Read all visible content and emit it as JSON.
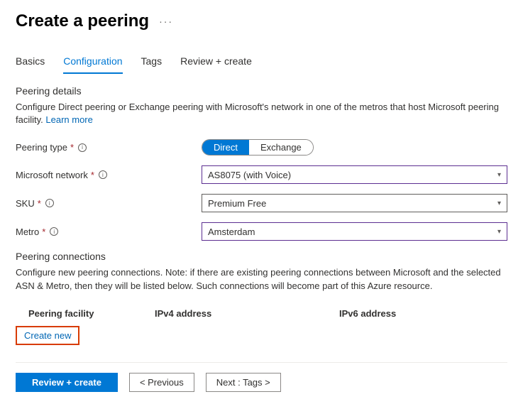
{
  "header": {
    "title": "Create a peering"
  },
  "tabs": [
    {
      "label": "Basics"
    },
    {
      "label": "Configuration"
    },
    {
      "label": "Tags"
    },
    {
      "label": "Review + create"
    }
  ],
  "active_tab_index": 1,
  "details": {
    "heading": "Peering details",
    "description": "Configure Direct peering or Exchange peering with Microsoft's network in one of the metros that host Microsoft peering facility. ",
    "learn_more": "Learn more"
  },
  "form": {
    "peering_type": {
      "label": "Peering type",
      "options": [
        "Direct",
        "Exchange"
      ],
      "selected": "Direct"
    },
    "microsoft_network": {
      "label": "Microsoft network",
      "value": "AS8075 (with Voice)"
    },
    "sku": {
      "label": "SKU",
      "value": "Premium Free"
    },
    "metro": {
      "label": "Metro",
      "value": "Amsterdam"
    }
  },
  "connections": {
    "heading": "Peering connections",
    "description": "Configure new peering connections. Note: if there are existing peering connections between Microsoft and the selected ASN & Metro, then they will be listed below. Such connections will become part of this Azure resource.",
    "columns": {
      "facility": "Peering facility",
      "ipv4": "IPv4 address",
      "ipv6": "IPv6 address"
    },
    "create_new": "Create new"
  },
  "footer": {
    "review": "Review + create",
    "previous": "< Previous",
    "next": "Next : Tags >"
  }
}
